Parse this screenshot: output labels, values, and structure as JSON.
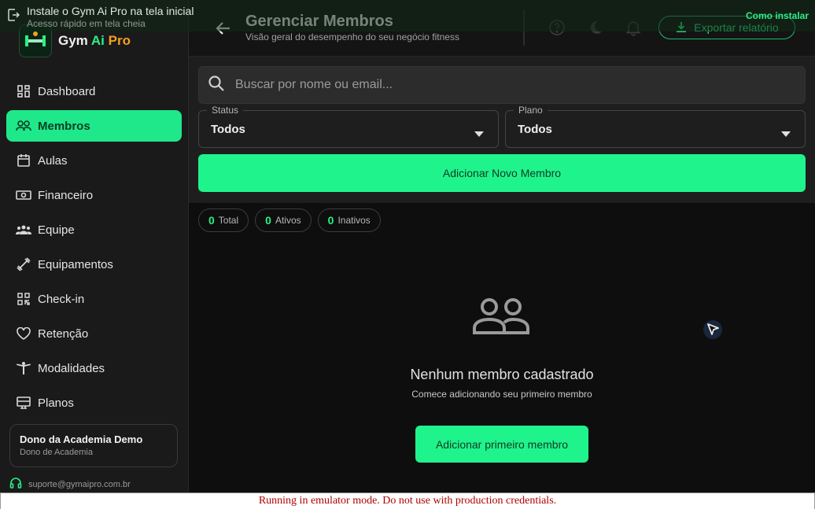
{
  "install_banner": {
    "title": "Instale o Gym Ai Pro na tela inicial",
    "subtitle": "Acesso rápido em tela cheia",
    "link": "Como instalar"
  },
  "brand": {
    "name_prefix": "Gym ",
    "name_ai": "Ai",
    "name_pro": " Pro"
  },
  "sidebar": {
    "items": [
      {
        "label": "Dashboard",
        "icon": "dashboard-icon",
        "active": false
      },
      {
        "label": "Membros",
        "icon": "people-icon",
        "active": true
      },
      {
        "label": "Aulas",
        "icon": "calendar-icon",
        "active": false
      },
      {
        "label": "Financeiro",
        "icon": "money-icon",
        "active": false
      },
      {
        "label": "Equipe",
        "icon": "team-icon",
        "active": false
      },
      {
        "label": "Equipamentos",
        "icon": "dumbbell-icon",
        "active": false
      },
      {
        "label": "Check-in",
        "icon": "qr-code-icon",
        "active": false
      },
      {
        "label": "Retenção",
        "icon": "heart-icon",
        "active": false
      },
      {
        "label": "Modalidades",
        "icon": "gymnastics-icon",
        "active": false
      },
      {
        "label": "Planos",
        "icon": "card-icon",
        "active": false
      }
    ],
    "user": {
      "name": "Dono da Academia Demo",
      "role": "Dono de Academia"
    },
    "support_email": "suporte@gymaipro.com.br"
  },
  "header": {
    "title": "Gerenciar Membros",
    "subtitle": "Visão geral do desempenho do seu negócio fitness",
    "export_label": "Exportar relatório"
  },
  "filters": {
    "search_placeholder": "Buscar por nome ou email...",
    "status_label": "Status",
    "status_value": "Todos",
    "plan_label": "Plano",
    "plan_value": "Todos",
    "add_button": "Adicionar Novo Membro"
  },
  "stats": [
    {
      "count": "0",
      "label": "Total"
    },
    {
      "count": "0",
      "label": "Ativos"
    },
    {
      "count": "0",
      "label": "Inativos"
    }
  ],
  "empty_state": {
    "title": "Nenhum membro cadastrado",
    "subtitle": "Comece adicionando seu primeiro membro",
    "button": "Adicionar primeiro membro"
  },
  "emulator_notice": "Running in emulator mode. Do not use with production credentials.",
  "colors": {
    "accent": "#1ff48c",
    "brand_orange": "#f5a01e",
    "background": "#0e0e0e"
  }
}
